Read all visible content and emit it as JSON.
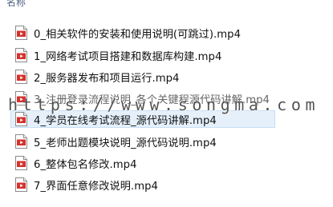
{
  "header": {
    "column_label": "名称"
  },
  "files": [
    {
      "name": "0_相关软件的安装和使用说明(可跳过).mp4",
      "icon": "video-file-icon"
    },
    {
      "name": "1_网络考试项目搭建和数据库构建.mp4",
      "icon": "video-file-icon"
    },
    {
      "name": "2_服务器发布和项目运行.mp4",
      "icon": "video-file-icon"
    },
    {
      "name": "3_注册登录流程说明_各个关键程源代码讲解.mp4",
      "icon": "video-file-icon"
    },
    {
      "name": "4_学员在线考试流程_源代码讲解.mp4",
      "icon": "video-file-icon"
    },
    {
      "name": "5_老师出题模块说明_源代码说明.mp4",
      "icon": "video-file-icon"
    },
    {
      "name": "6_整体包名修改.mp4",
      "icon": "video-file-icon"
    },
    {
      "name": "7_界面任意修改说明.mp4",
      "icon": "video-file-icon"
    }
  ],
  "selected_index": 4,
  "watermark": "https://www.songma.com",
  "colors": {
    "selection_bg": "#e5f0fb",
    "selection_border": "#c7def5",
    "header_text": "#4d6082",
    "icon_red": "#d4322c"
  }
}
